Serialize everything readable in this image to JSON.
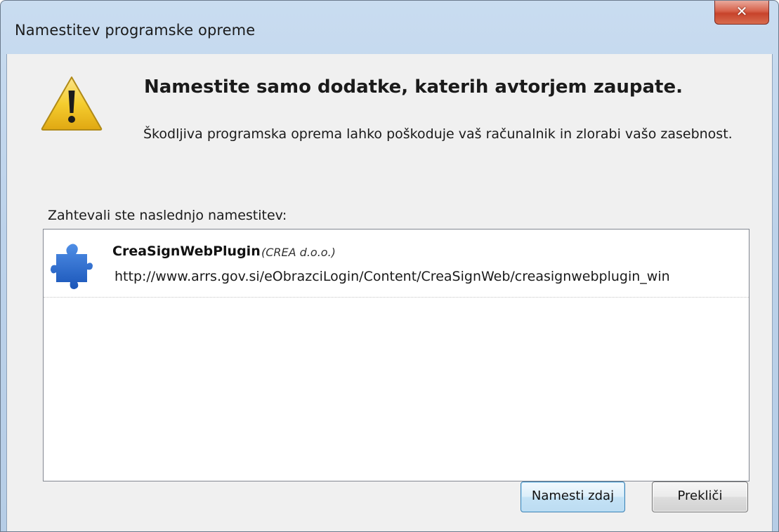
{
  "window": {
    "title": "Namestitev programske opreme",
    "close_icon": "close-icon"
  },
  "warning": {
    "icon": "warning-icon",
    "heading": "Namestite samo dodatke, katerih avtorjem zaupate.",
    "description": "Škodljiva programska oprema lahko poškoduje vaš računalnik in zlorabi vašo zasebnost."
  },
  "install_list": {
    "label": "Zahtevali ste naslednjo namestitev:",
    "items": [
      {
        "icon": "puzzle-icon",
        "name": "CreaSignWebPlugin",
        "vendor": "(CREA d.o.o.)",
        "url": "http://www.arrs.gov.si/eObrazciLogin/Content/CreaSignWeb/creasignwebplugin_win"
      }
    ]
  },
  "buttons": {
    "install_label": "Namesti zdaj",
    "cancel_label": "Prekliči"
  },
  "colors": {
    "title_bar": "#c0d5ec",
    "close_button": "#c7432b",
    "install_border": "#3c7fb1",
    "puzzle_blue": "#2466c8",
    "warning_yellow": "#f5cd2f"
  }
}
